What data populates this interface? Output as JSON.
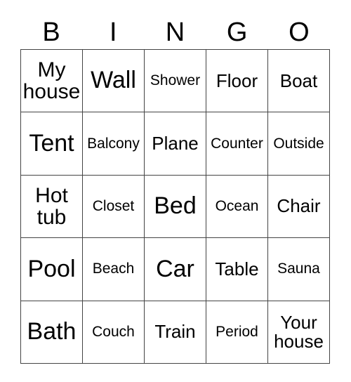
{
  "card": {
    "header_letters": [
      "B",
      "I",
      "N",
      "G",
      "O"
    ],
    "rows": [
      [
        {
          "label": "My house",
          "size": "lg"
        },
        {
          "label": "Wall",
          "size": "xl"
        },
        {
          "label": "Shower",
          "size": "sm"
        },
        {
          "label": "Floor",
          "size": "md"
        },
        {
          "label": "Boat",
          "size": "md"
        }
      ],
      [
        {
          "label": "Tent",
          "size": "xl"
        },
        {
          "label": "Balcony",
          "size": "sm"
        },
        {
          "label": "Plane",
          "size": "md"
        },
        {
          "label": "Counter",
          "size": "sm"
        },
        {
          "label": "Outside",
          "size": "sm"
        }
      ],
      [
        {
          "label": "Hot tub",
          "size": "lg"
        },
        {
          "label": "Closet",
          "size": "sm"
        },
        {
          "label": "Bed",
          "size": "xl"
        },
        {
          "label": "Ocean",
          "size": "sm"
        },
        {
          "label": "Chair",
          "size": "md"
        }
      ],
      [
        {
          "label": "Pool",
          "size": "xl"
        },
        {
          "label": "Beach",
          "size": "sm"
        },
        {
          "label": "Car",
          "size": "xl"
        },
        {
          "label": "Table",
          "size": "md"
        },
        {
          "label": "Sauna",
          "size": "sm"
        }
      ],
      [
        {
          "label": "Bath",
          "size": "xl"
        },
        {
          "label": "Couch",
          "size": "sm"
        },
        {
          "label": "Train",
          "size": "md"
        },
        {
          "label": "Period",
          "size": "sm"
        },
        {
          "label": "Your house",
          "size": "md"
        }
      ]
    ],
    "colors": {
      "border": "#444444",
      "text": "#000000",
      "background": "#ffffff"
    }
  }
}
